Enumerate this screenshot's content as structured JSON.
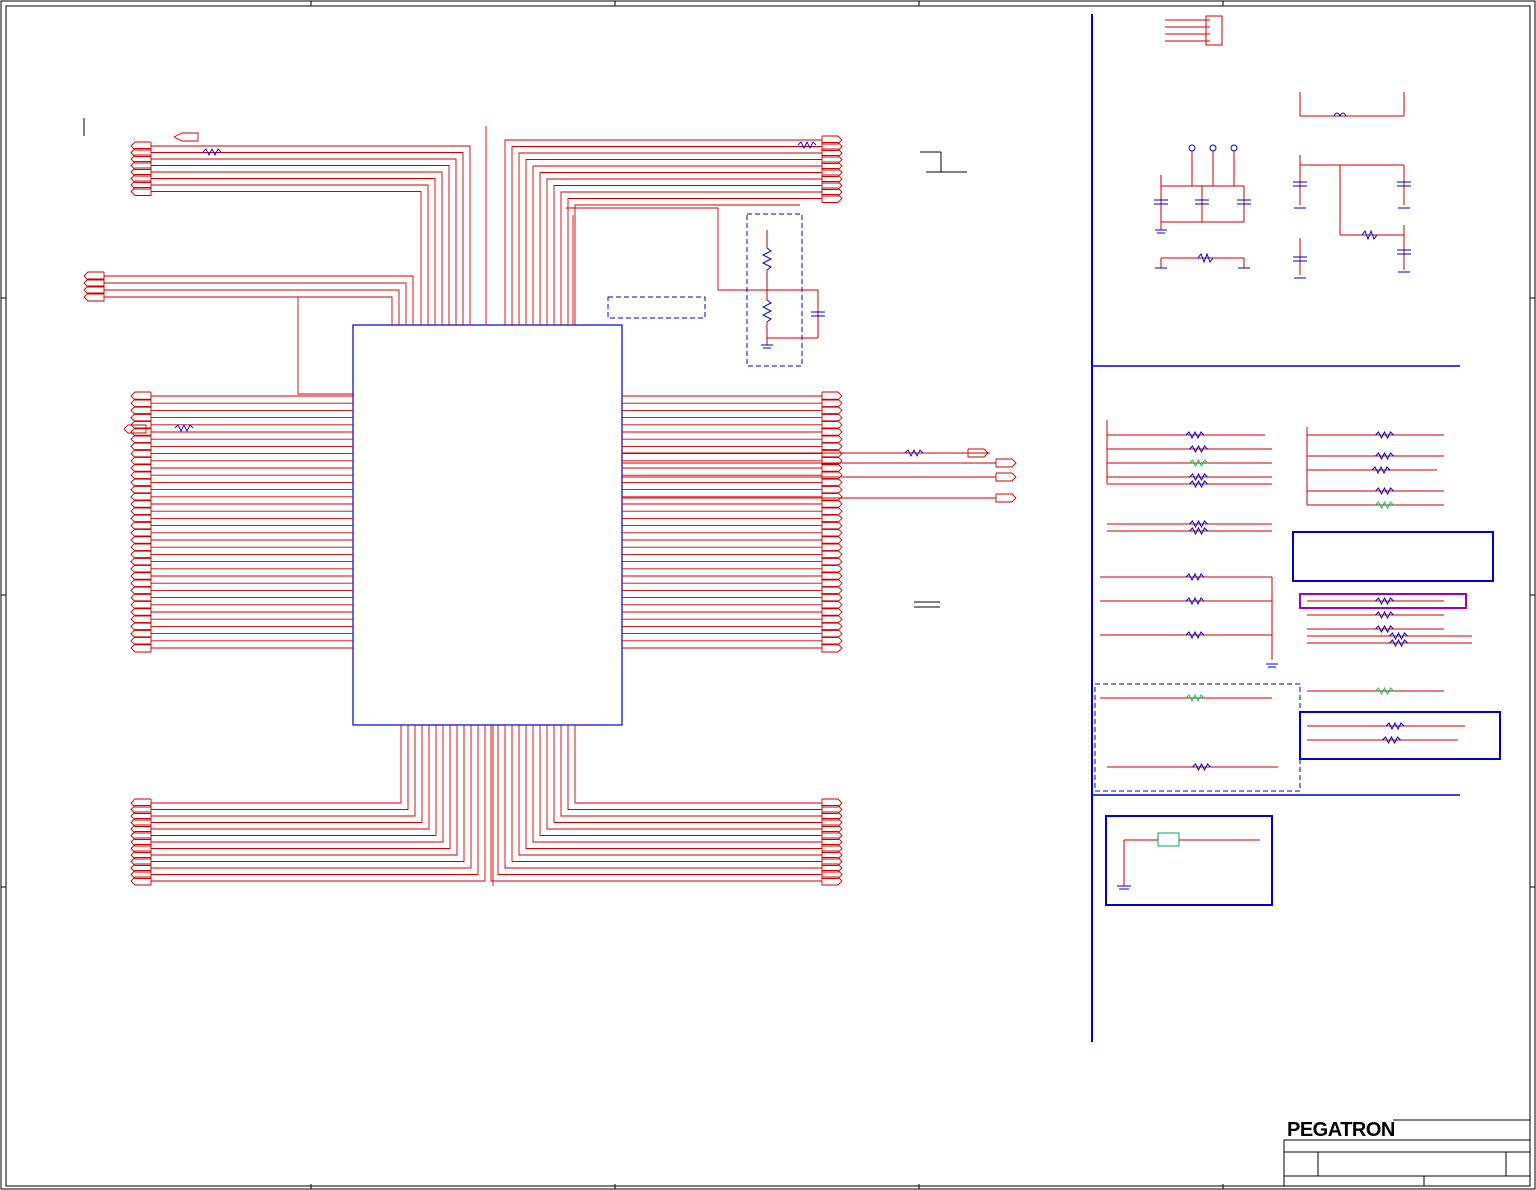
{
  "title_block": {
    "logo_text": "PEGATRON"
  },
  "colors": {
    "net_wire": "#cc0000",
    "component": "#0000cc",
    "border": "#000000",
    "highlight_purple": "#9900cc",
    "highlight_green": "#00cc66"
  }
}
